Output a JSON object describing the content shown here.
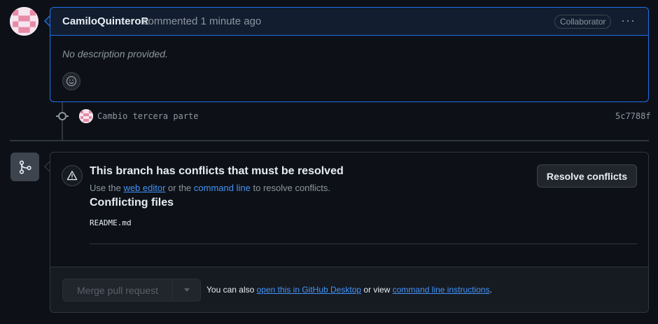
{
  "comment": {
    "author": "CamiloQuinteroR",
    "action": "commented 1 minute ago",
    "badge": "Collaborator",
    "menu_icon": "kebab-horizontal-icon",
    "body": "No description provided.",
    "reaction_icon": "smiley-icon"
  },
  "commit": {
    "message": "Cambio tercera parte",
    "sha": "5c7788f"
  },
  "merge": {
    "title": "This branch has conflicts that must be resolved",
    "sub_prefix": "Use the",
    "web_editor_link": "web editor",
    "sub_mid": "or the",
    "command_line_link": "command line",
    "sub_suffix": "to resolve conflicts.",
    "resolve_button": "Resolve conflicts",
    "conflicting_heading": "Conflicting files",
    "files": [
      "README.md"
    ],
    "merge_button": "Merge pull request",
    "footer_prefix": "You can also",
    "desktop_link": "open this in GitHub Desktop",
    "footer_mid": "or view",
    "instructions_link": "command line instructions",
    "footer_suffix": "."
  },
  "colors": {
    "background": "#0d1117",
    "accent_blue": "#1f6feb",
    "link": "#4493f8",
    "muted": "#8d96a0",
    "border": "#30363d"
  }
}
